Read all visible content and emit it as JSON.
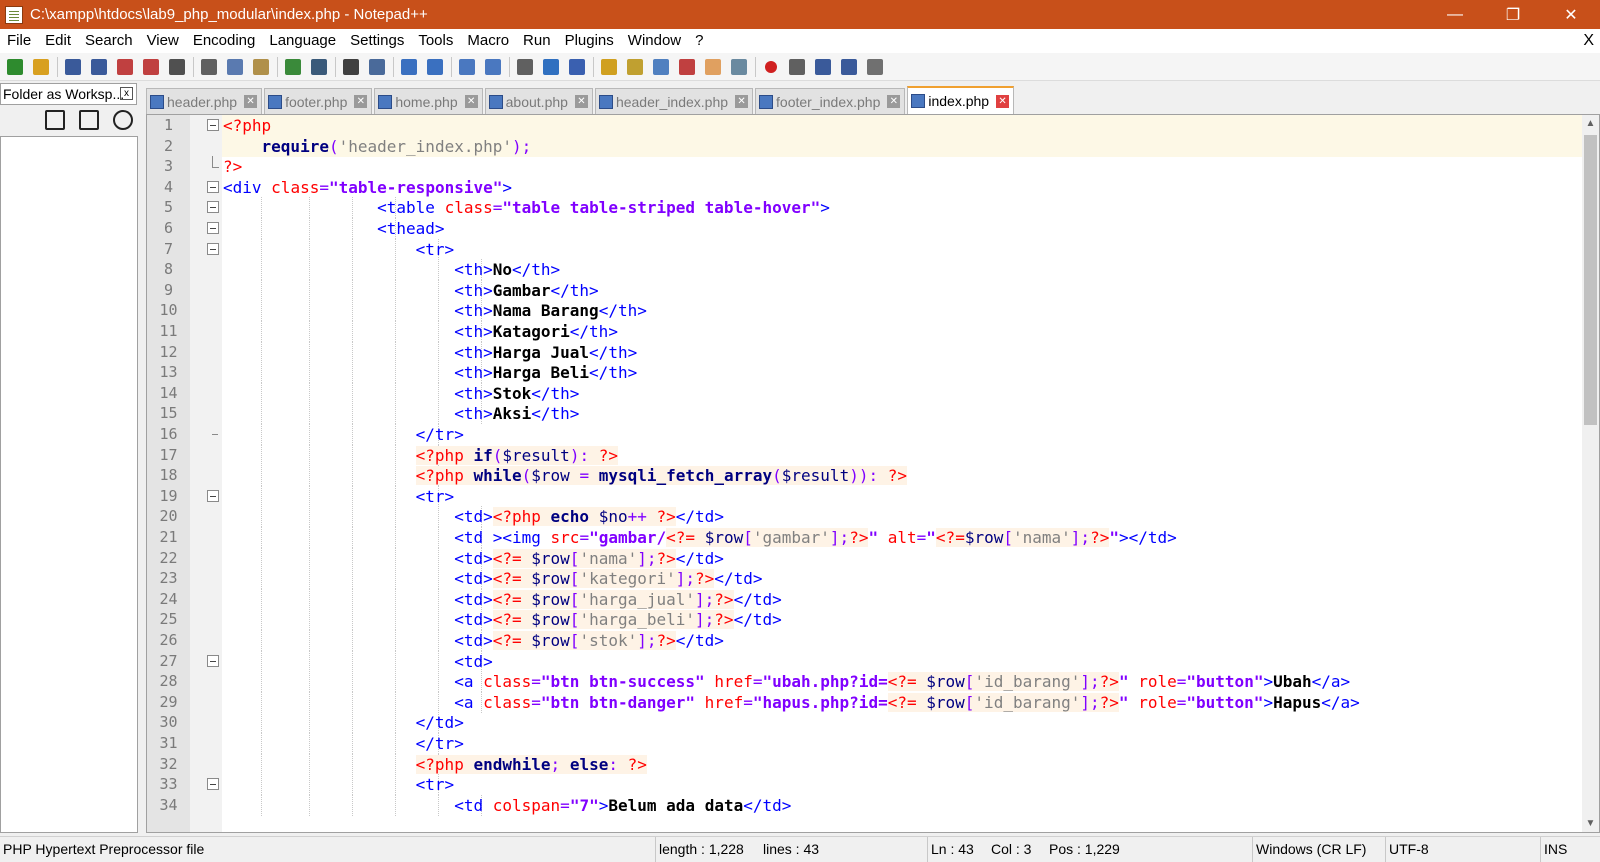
{
  "window": {
    "title": "C:\\xampp\\htdocs\\lab9_php_modular\\index.php - Notepad++",
    "minimize": "—",
    "maximize": "❐",
    "close": "✕"
  },
  "menu": {
    "items": [
      "File",
      "Edit",
      "Search",
      "View",
      "Encoding",
      "Language",
      "Settings",
      "Tools",
      "Macro",
      "Run",
      "Plugins",
      "Window",
      "?"
    ],
    "close_doc": "X"
  },
  "toolbar": {
    "icons": [
      "new-file-icon",
      "open-file-icon",
      "save-icon",
      "save-all-icon",
      "close-icon",
      "close-all-icon",
      "print-icon",
      "cut-icon",
      "copy-icon",
      "paste-icon",
      "undo-icon",
      "redo-icon",
      "find-icon",
      "replace-icon",
      "zoom-in-icon",
      "zoom-out-icon",
      "sync-vertical-icon",
      "sync-horizontal-icon",
      "word-wrap-icon",
      "show-all-chars-icon",
      "indent-guide-icon",
      "user-language-icon",
      "doc-map-icon",
      "function-list-icon",
      "doc-list-icon",
      "folder-workspace-icon",
      "monitoring-icon",
      "record-macro-icon",
      "stop-macro-icon",
      "play-macro-icon",
      "run-macro-multiple-icon",
      "save-macro-icon"
    ],
    "colors": [
      "#2e8b2e",
      "#d8a020",
      "#3a5a9a",
      "#3a5a9a",
      "#c04040",
      "#c04040",
      "#505050",
      "#606060",
      "#5a7ab0",
      "#b0904a",
      "#3a8a3a",
      "#3a5a7a",
      "#404040",
      "#4a6a9a",
      "#3a70c0",
      "#3a70c0",
      "#4a78c0",
      "#4a78c0",
      "#606060",
      "#3070c0",
      "#3a60b0",
      "#d0a020",
      "#c0a030",
      "#5080c0",
      "#c04040",
      "#e0a060",
      "#6a8aa0",
      "#d02020",
      "#606060",
      "#3a5a9a",
      "#3a5a9a",
      "#707070"
    ]
  },
  "panel": {
    "title": "Folder as Worksp...",
    "close": "x",
    "tools": [
      "expand-all-icon",
      "collapse-all-icon",
      "locate-file-icon"
    ]
  },
  "tabs": [
    {
      "label": "header.php",
      "active": false
    },
    {
      "label": "footer.php",
      "active": false
    },
    {
      "label": "home.php",
      "active": false
    },
    {
      "label": "about.php",
      "active": false
    },
    {
      "label": "header_index.php",
      "active": false
    },
    {
      "label": "footer_index.php",
      "active": false
    },
    {
      "label": "index.php",
      "active": true
    }
  ],
  "code_lines": [
    {
      "n": "1",
      "fold": "box",
      "indent": 0,
      "html": "<span class='t-red'>&lt;?php</span>"
    },
    {
      "n": "2",
      "fold": "",
      "indent": 0,
      "html": "    <span class='t-kw'>require</span><span class='t-op'>(</span><span class='t-str'>'header_index.php'</span><span class='t-op'>);</span>"
    },
    {
      "n": "3",
      "fold": "end",
      "indent": 0,
      "html": "<span class='t-red'>?&gt;</span>"
    },
    {
      "n": "4",
      "fold": "box",
      "indent": 0,
      "html": "<span class='t-blue'>&lt;div</span> <span class='t-attr'>class</span><span class='t-op'>=</span><span class='t-aval'>\"table-responsive\"</span><span class='t-blue'>&gt;</span>"
    },
    {
      "n": "5",
      "fold": "box",
      "indent": 4,
      "html": "                <span class='t-blue'>&lt;table</span> <span class='t-attr'>class</span><span class='t-op'>=</span><span class='t-aval'>\"table table-striped table-hover\"</span><span class='t-blue'>&gt;</span>"
    },
    {
      "n": "6",
      "fold": "box",
      "indent": 4,
      "html": "                <span class='t-blue'>&lt;thead&gt;</span>"
    },
    {
      "n": "7",
      "fold": "box",
      "indent": 5,
      "html": "                    <span class='t-blue'>&lt;tr&gt;</span>"
    },
    {
      "n": "8",
      "fold": "",
      "indent": 6,
      "html": "                        <span class='t-blue'>&lt;th&gt;</span><span class='t-txt'>No</span><span class='t-blue'>&lt;/th&gt;</span>"
    },
    {
      "n": "9",
      "fold": "",
      "indent": 6,
      "html": "                        <span class='t-blue'>&lt;th&gt;</span><span class='t-txt'>Gambar</span><span class='t-blue'>&lt;/th&gt;</span>"
    },
    {
      "n": "10",
      "fold": "",
      "indent": 6,
      "html": "                        <span class='t-blue'>&lt;th&gt;</span><span class='t-txt'>Nama Barang</span><span class='t-blue'>&lt;/th&gt;</span>"
    },
    {
      "n": "11",
      "fold": "",
      "indent": 6,
      "html": "                        <span class='t-blue'>&lt;th&gt;</span><span class='t-txt'>Katagori</span><span class='t-blue'>&lt;/th&gt;</span>"
    },
    {
      "n": "12",
      "fold": "",
      "indent": 6,
      "html": "                        <span class='t-blue'>&lt;th&gt;</span><span class='t-txt'>Harga Jual</span><span class='t-blue'>&lt;/th&gt;</span>"
    },
    {
      "n": "13",
      "fold": "",
      "indent": 6,
      "html": "                        <span class='t-blue'>&lt;th&gt;</span><span class='t-txt'>Harga Beli</span><span class='t-blue'>&lt;/th&gt;</span>"
    },
    {
      "n": "14",
      "fold": "",
      "indent": 6,
      "html": "                        <span class='t-blue'>&lt;th&gt;</span><span class='t-txt'>Stok</span><span class='t-blue'>&lt;/th&gt;</span>"
    },
    {
      "n": "15",
      "fold": "",
      "indent": 6,
      "html": "                        <span class='t-blue'>&lt;th&gt;</span><span class='t-txt'>Aksi</span><span class='t-blue'>&lt;/th&gt;</span>"
    },
    {
      "n": "16",
      "fold": "tick",
      "indent": 5,
      "html": "                    <span class='t-blue'>&lt;/tr&gt;</span>"
    },
    {
      "n": "17",
      "fold": "",
      "indent": 5,
      "html": "                    <span class='t-red t-phpbg'>&lt;?php</span><span class='t-phpbg'> <span class='t-kw'>if</span><span class='t-op'>(</span><span class='t-var'>$result</span><span class='t-op'>):</span> </span><span class='t-red t-phpbg'>?&gt;</span>"
    },
    {
      "n": "18",
      "fold": "",
      "indent": 5,
      "html": "                    <span class='t-red t-phpbg'>&lt;?php</span><span class='t-phpbg'> <span class='t-kw'>while</span><span class='t-op'>(</span><span class='t-var'>$row</span> <span class='t-op'>=</span> <span class='t-fn'>mysqli_fetch_array</span><span class='t-op'>(</span><span class='t-var'>$result</span><span class='t-op'>)):</span> </span><span class='t-red t-phpbg'>?&gt;</span>"
    },
    {
      "n": "19",
      "fold": "box",
      "indent": 5,
      "html": "                    <span class='t-blue'>&lt;tr&gt;</span>"
    },
    {
      "n": "20",
      "fold": "",
      "indent": 6,
      "html": "                        <span class='t-blue'>&lt;td&gt;</span><span class='t-red t-phpbg'>&lt;?php</span><span class='t-phpbg'> <span class='t-kw'>echo</span> <span class='t-var'>$no</span><span class='t-op'>++</span> </span><span class='t-red t-phpbg'>?&gt;</span><span class='t-blue'>&lt;/td&gt;</span>"
    },
    {
      "n": "21",
      "fold": "",
      "indent": 6,
      "html": "                        <span class='t-blue'>&lt;td &gt;&lt;img</span> <span class='t-attr'>src</span><span class='t-op'>=</span><span class='t-aval'>\"gambar/</span><span class='t-red t-phpbg'>&lt;?=</span><span class='t-phpbg'> <span class='t-var'>$row</span><span class='t-op'>[</span><span class='t-str'>'gambar'</span><span class='t-op'>];</span></span><span class='t-red t-phpbg'>?&gt;</span><span class='t-aval'>\"</span> <span class='t-attr'>alt</span><span class='t-op'>=</span><span class='t-aval'>\"</span><span class='t-red t-phpbg'>&lt;?=</span><span class='t-phpbg'><span class='t-var'>$row</span><span class='t-op'>[</span><span class='t-str'>'nama'</span><span class='t-op'>];</span></span><span class='t-red t-phpbg'>?&gt;</span><span class='t-aval'>\"</span><span class='t-blue'>&gt;&lt;/td&gt;</span>"
    },
    {
      "n": "22",
      "fold": "",
      "indent": 6,
      "html": "                        <span class='t-blue'>&lt;td&gt;</span><span class='t-red t-phpbg'>&lt;?=</span><span class='t-phpbg'> <span class='t-var'>$row</span><span class='t-op'>[</span><span class='t-str'>'nama'</span><span class='t-op'>];</span></span><span class='t-red t-phpbg'>?&gt;</span><span class='t-blue'>&lt;/td&gt;</span>"
    },
    {
      "n": "23",
      "fold": "",
      "indent": 6,
      "html": "                        <span class='t-blue'>&lt;td&gt;</span><span class='t-red t-phpbg'>&lt;?=</span><span class='t-phpbg'> <span class='t-var'>$row</span><span class='t-op'>[</span><span class='t-str'>'kategori'</span><span class='t-op'>];</span></span><span class='t-red t-phpbg'>?&gt;</span><span class='t-blue'>&lt;/td&gt;</span>"
    },
    {
      "n": "24",
      "fold": "",
      "indent": 6,
      "html": "                        <span class='t-blue'>&lt;td&gt;</span><span class='t-red t-phpbg'>&lt;?=</span><span class='t-phpbg'> <span class='t-var'>$row</span><span class='t-op'>[</span><span class='t-str'>'harga_jual'</span><span class='t-op'>];</span></span><span class='t-red t-phpbg'>?&gt;</span><span class='t-blue'>&lt;/td&gt;</span>"
    },
    {
      "n": "25",
      "fold": "",
      "indent": 6,
      "html": "                        <span class='t-blue'>&lt;td&gt;</span><span class='t-red t-phpbg'>&lt;?=</span><span class='t-phpbg'> <span class='t-var'>$row</span><span class='t-op'>[</span><span class='t-str'>'harga_beli'</span><span class='t-op'>];</span></span><span class='t-red t-phpbg'>?&gt;</span><span class='t-blue'>&lt;/td&gt;</span>"
    },
    {
      "n": "26",
      "fold": "",
      "indent": 6,
      "html": "                        <span class='t-blue'>&lt;td&gt;</span><span class='t-red t-phpbg'>&lt;?=</span><span class='t-phpbg'> <span class='t-var'>$row</span><span class='t-op'>[</span><span class='t-str'>'stok'</span><span class='t-op'>];</span></span><span class='t-red t-phpbg'>?&gt;</span><span class='t-blue'>&lt;/td&gt;</span>"
    },
    {
      "n": "27",
      "fold": "box",
      "indent": 6,
      "html": "                        <span class='t-blue'>&lt;td&gt;</span>"
    },
    {
      "n": "28",
      "fold": "",
      "indent": 6,
      "html": "                        <span class='t-blue'>&lt;a</span> <span class='t-attr'>class</span><span class='t-op'>=</span><span class='t-aval'>\"btn btn-success\"</span> <span class='t-attr'>href</span><span class='t-op'>=</span><span class='t-aval'>\"ubah.php?id=</span><span class='t-red t-phpbg'>&lt;?=</span><span class='t-phpbg'> <span class='t-var'>$row</span><span class='t-op'>[</span><span class='t-str'>'id_barang'</span><span class='t-op'>];</span></span><span class='t-red t-phpbg'>?&gt;</span><span class='t-aval'>\"</span> <span class='t-attr'>role</span><span class='t-op'>=</span><span class='t-aval'>\"button\"</span><span class='t-blue'>&gt;</span><span class='t-txt'>Ubah</span><span class='t-blue'>&lt;/a&gt;</span>"
    },
    {
      "n": "29",
      "fold": "",
      "indent": 6,
      "html": "                        <span class='t-blue'>&lt;a</span> <span class='t-attr'>class</span><span class='t-op'>=</span><span class='t-aval'>\"btn btn-danger\"</span> <span class='t-attr'>href</span><span class='t-op'>=</span><span class='t-aval'>\"hapus.php?id=</span><span class='t-red t-phpbg'>&lt;?=</span><span class='t-phpbg'> <span class='t-var'>$row</span><span class='t-op'>[</span><span class='t-str'>'id_barang'</span><span class='t-op'>];</span></span><span class='t-red t-phpbg'>?&gt;</span><span class='t-aval'>\"</span> <span class='t-attr'>role</span><span class='t-op'>=</span><span class='t-aval'>\"button\"</span><span class='t-blue'>&gt;</span><span class='t-txt'>Hapus</span><span class='t-blue'>&lt;/a&gt;</span>"
    },
    {
      "n": "30",
      "fold": "",
      "indent": 5,
      "html": "                    <span class='t-blue'>&lt;/td&gt;</span>"
    },
    {
      "n": "31",
      "fold": "",
      "indent": 5,
      "html": "                    <span class='t-blue'>&lt;/tr&gt;</span>"
    },
    {
      "n": "32",
      "fold": "",
      "indent": 5,
      "html": "                    <span class='t-red t-phpbg'>&lt;?php</span><span class='t-phpbg'> <span class='t-kw'>endwhile</span><span class='t-op'>;</span> <span class='t-kw'>else</span><span class='t-op'>:</span> </span><span class='t-red t-phpbg'>?&gt;</span>"
    },
    {
      "n": "33",
      "fold": "box",
      "indent": 5,
      "html": "                    <span class='t-blue'>&lt;tr&gt;</span>"
    },
    {
      "n": "34",
      "fold": "",
      "indent": 6,
      "html": "                        <span class='t-blue'>&lt;td</span> <span class='t-attr'>colspan</span><span class='t-op'>=</span><span class='t-aval'>\"7\"</span><span class='t-blue'>&gt;</span><span class='t-txt'>Belum ada data</span><span class='t-blue'>&lt;/td&gt;</span>"
    }
  ],
  "scrollbar": {
    "up": "▲",
    "down": "▼"
  },
  "status": {
    "file_type": "PHP Hypertext Preprocessor file",
    "length": "length : 1,228",
    "lines": "lines : 43",
    "ln": "Ln : 43",
    "col": "Col : 3",
    "pos": "Pos : 1,229",
    "eol": "Windows (CR LF)",
    "encoding": "UTF-8",
    "mode": "INS"
  }
}
